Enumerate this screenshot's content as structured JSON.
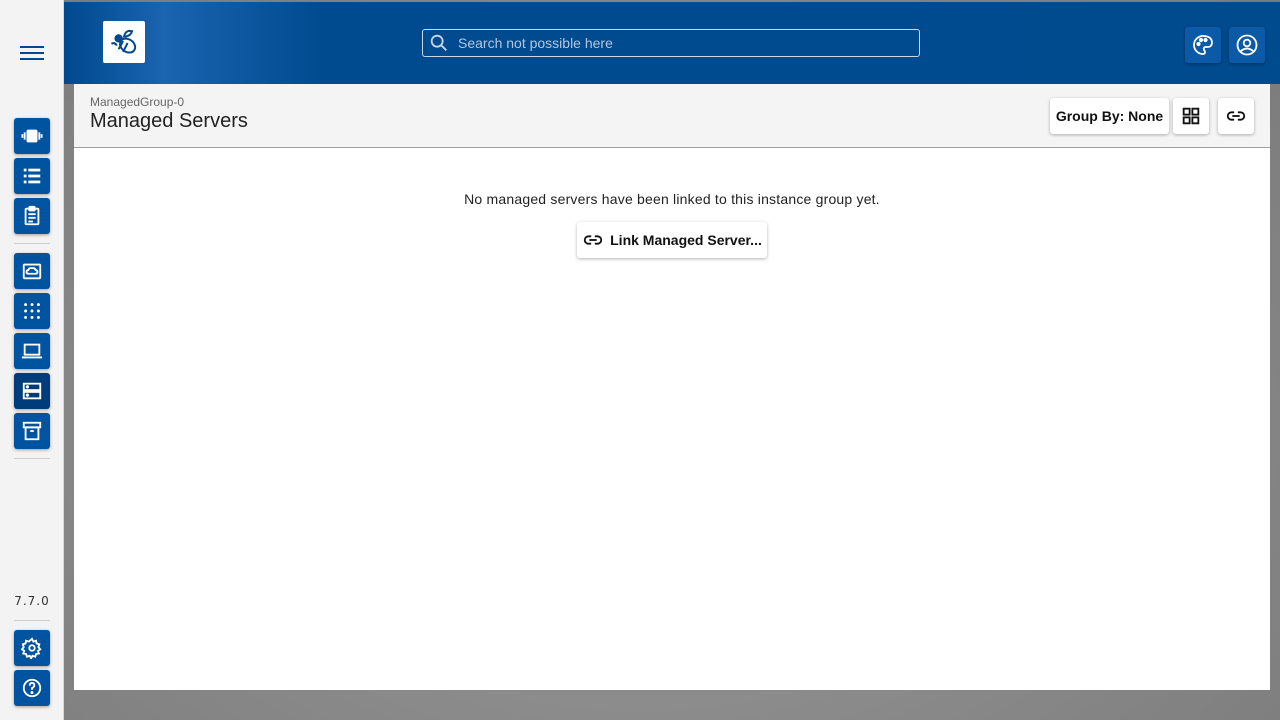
{
  "search": {
    "placeholder": "Search not possible here"
  },
  "header": {
    "breadcrumb": "ManagedGroup-0",
    "title": "Managed Servers",
    "group_by_label": "Group By: None"
  },
  "main": {
    "empty_message": "No managed servers have been linked to this instance group yet.",
    "link_button_label": "Link Managed Server..."
  },
  "sidenav": {
    "version": "7.7.0",
    "items": [
      {
        "icon": "carousel-icon"
      },
      {
        "icon": "list-icon"
      },
      {
        "icon": "clipboard-icon"
      },
      {
        "icon": "cloud-drive-icon"
      },
      {
        "icon": "apps-grid-icon"
      },
      {
        "icon": "laptop-icon"
      },
      {
        "icon": "servers-icon"
      },
      {
        "icon": "archive-icon"
      },
      {
        "icon": "gear-icon"
      },
      {
        "icon": "help-icon"
      }
    ]
  },
  "colors": {
    "brand": "#00498f",
    "button": "#00549f",
    "active": "#003c7a"
  }
}
